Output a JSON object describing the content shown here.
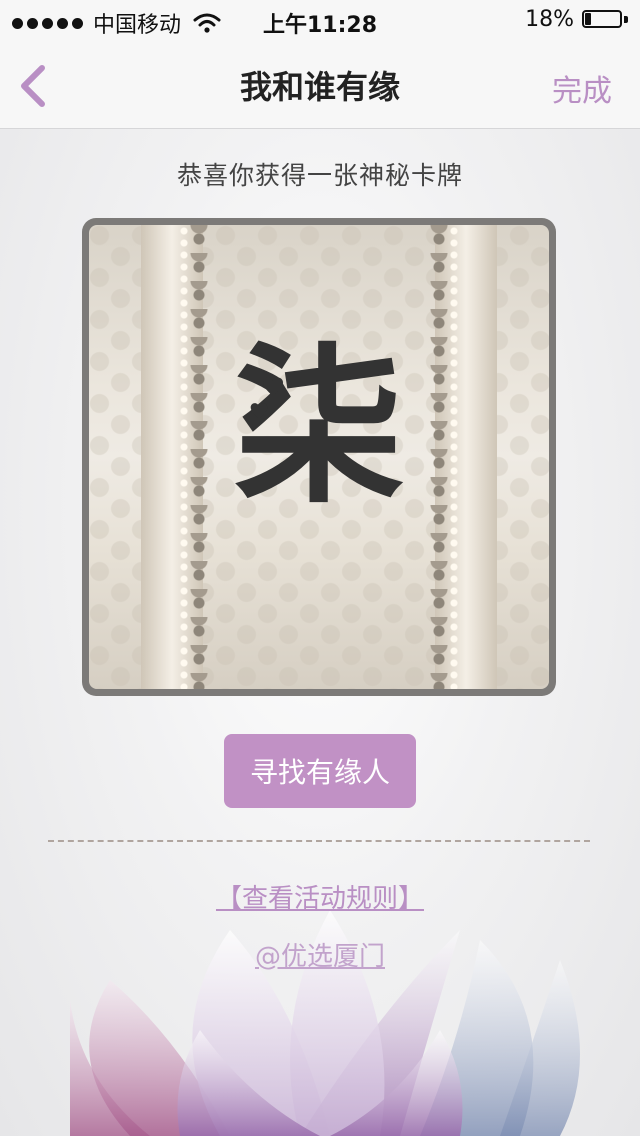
{
  "status_bar": {
    "carrier": "中国移动",
    "time": "上午11:28",
    "battery": "18%",
    "battery_level": 0.18,
    "signal_bars": 5
  },
  "nav": {
    "title": "我和谁有缘",
    "done_label": "完成",
    "back_icon": "chevron-left-icon"
  },
  "main": {
    "subtitle": "恭喜你获得一张神秘卡牌",
    "card": {
      "glyph": "柒"
    },
    "find_button_label": "寻找有缘人",
    "rules_link": "【查看活动规则】",
    "source_link": "@优选厦门"
  },
  "colors": {
    "accent": "#c191c5",
    "link": "#b98fc4",
    "card_frame": "#7c7a78"
  }
}
